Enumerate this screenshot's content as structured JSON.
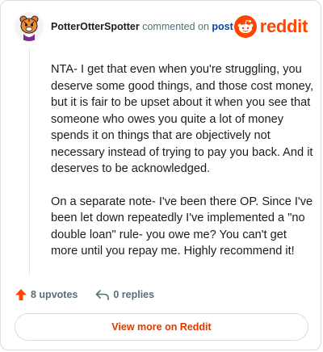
{
  "header": {
    "username": "PotterOtterSpotter",
    "action_text": "commented on",
    "link_text": "post",
    "brand_name": "reddit",
    "avatar_icon": "tiger-avatar-icon",
    "brand_icon": "reddit-snoo-icon"
  },
  "comment": {
    "paragraphs": [
      "NTA- I get that even when you're struggling, you deserve some good things, and those cost money, but it is fair to be upset about it when you see that someone who owes you quite a lot of money spends it on things that are objectively not necessary instead of trying to pay you back. And it deserves to be acknowledged.",
      "On a separate note- I've been there OP. Since I've been let down repeatedly I've implemented a \"no double loan\" rule- you owe me? You can't get more until you repay me. Highly recommend it!"
    ]
  },
  "actions": {
    "upvotes_label": "8 upvotes",
    "replies_label": "0 replies",
    "upvote_icon": "upvote-arrow-icon",
    "reply_icon": "reply-arrow-icon"
  },
  "footer": {
    "view_more_label": "View more on Reddit"
  },
  "colors": {
    "brand_orange": "#ff4500",
    "link_blue": "#0a449b",
    "muted_text": "#576f76",
    "view_more_text": "#d93a00"
  }
}
